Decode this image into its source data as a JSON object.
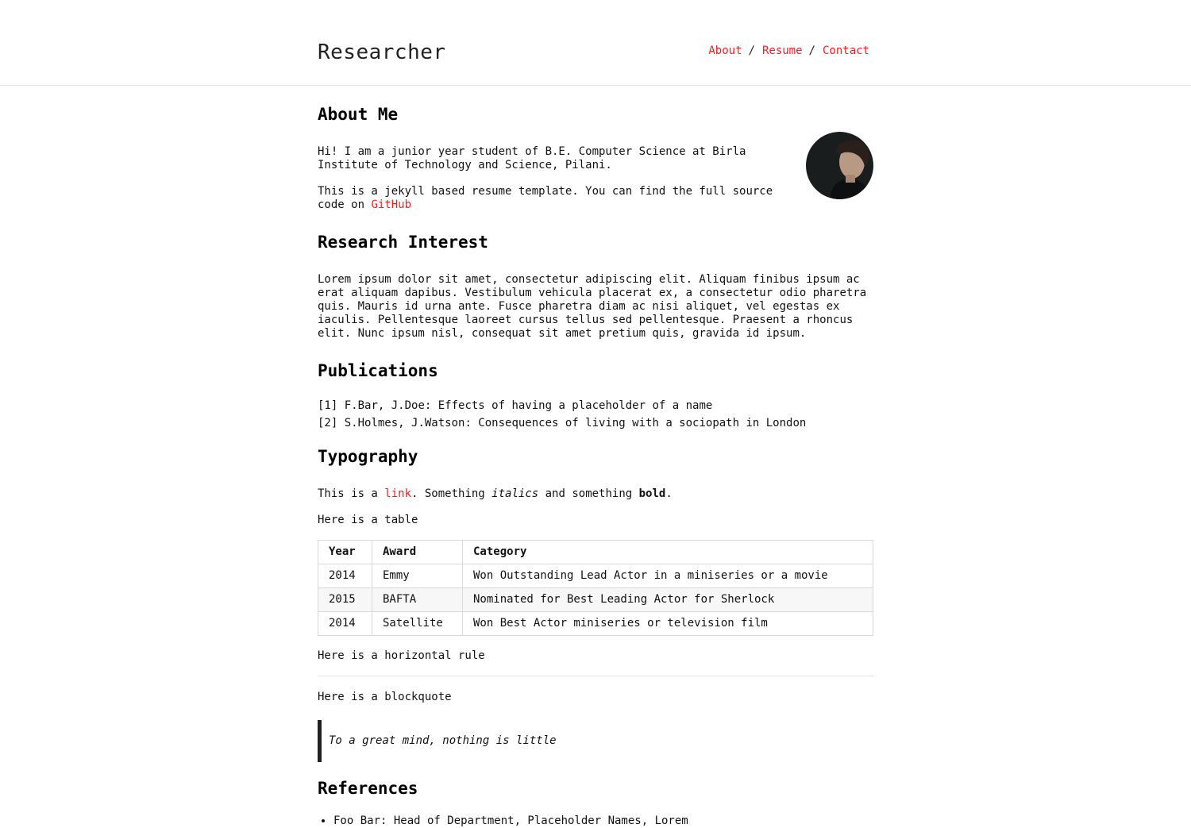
{
  "header": {
    "title": "Researcher",
    "nav": [
      "About",
      "Resume",
      "Contact"
    ],
    "separator": "/"
  },
  "about": {
    "heading": "About Me",
    "para1": "Hi! I am a junior year student of B.E. Computer Science at Birla Institute of Technology and Science, Pilani.",
    "para2_text": "This is a jekyll based resume template. You can find the full source code on",
    "para2_link": "GitHub"
  },
  "research": {
    "heading": "Research Interest",
    "text": "Lorem ipsum dolor sit amet, consectetur adipiscing elit. Aliquam finibus ipsum ac erat aliquam dapibus. Vestibulum vehicula placerat ex, a consectetur odio pharetra quis. Mauris id urna ante. Fusce pharetra diam ac nisi aliquet, vel egestas ex iaculis. Pellentesque laoreet cursus tellus sed pellentesque. Praesent a rhoncus elit. Nunc ipsum nisl, consequat sit amet pretium quis, gravida id ipsum."
  },
  "publications": {
    "heading": "Publications",
    "items": [
      {
        "num": "[1]",
        "text": "F.Bar, J.Doe: Effects of having a placeholder of a name"
      },
      {
        "num": "[2]",
        "text": "S.Holmes, J.Watson: Consequences of living with a sociopath in London"
      }
    ]
  },
  "typography": {
    "heading": "Typography",
    "line_before_link": "This is a ",
    "link": "link",
    "after_link": ". Something ",
    "italics": "italics",
    "mid": " and something ",
    "bold": "bold",
    "end": ".",
    "table_intro": "Here is a table",
    "table": {
      "headers": [
        "Year",
        "Award",
        "Category"
      ],
      "rows": [
        [
          "2014",
          "Emmy",
          "Won Outstanding Lead Actor in a miniseries or a movie"
        ],
        [
          "2015",
          "BAFTA",
          "Nominated for Best Leading Actor for Sherlock"
        ],
        [
          "2014",
          "Satellite",
          "Won Best Actor miniseries or television film"
        ]
      ]
    },
    "hr_intro": "Here is a horizontal rule",
    "quote_intro": "Here is a blockquote",
    "quote": "To a great mind, nothing is little"
  },
  "references": {
    "heading": "References",
    "items": [
      "Foo Bar: Head of Department, Placeholder Names, Lorem"
    ]
  },
  "colors": {
    "link": "#ff1a1a",
    "text": "#111111",
    "rule": "#e2e2e2"
  }
}
